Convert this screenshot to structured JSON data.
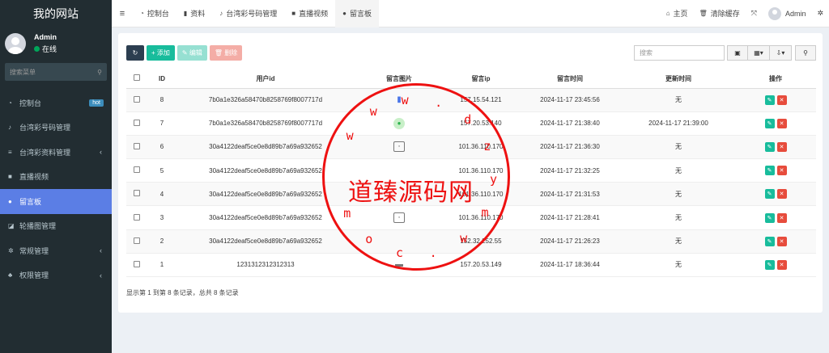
{
  "app": {
    "title": "我的网站"
  },
  "user": {
    "name": "Admin",
    "status": "在线"
  },
  "sidebar": {
    "search_placeholder": "搜索菜单",
    "items": [
      {
        "label": "控制台",
        "icon": "dashboard-icon",
        "badge": "hot"
      },
      {
        "label": "台湾彩号码管理",
        "icon": "bell-icon"
      },
      {
        "label": "台湾彩资料管理",
        "icon": "list-icon",
        "arrow": "‹"
      },
      {
        "label": "直播视频",
        "icon": "video-icon"
      },
      {
        "label": "留言板",
        "icon": "comment-icon"
      },
      {
        "label": "轮播图管理",
        "icon": "image-icon"
      },
      {
        "label": "常规管理",
        "icon": "cogs-icon",
        "arrow": "‹"
      },
      {
        "label": "权限管理",
        "icon": "users-icon",
        "arrow": "‹"
      }
    ]
  },
  "topbar": {
    "tabs": [
      {
        "label": "控制台",
        "icon": "dashboard-icon"
      },
      {
        "label": "资料",
        "icon": "bookmark-icon"
      },
      {
        "label": "台湾彩号码管理",
        "icon": "bell-icon"
      },
      {
        "label": "直播视频",
        "icon": "video-icon"
      },
      {
        "label": "留言板",
        "icon": "comment-icon"
      }
    ],
    "home": "主页",
    "clear_cache": "清除缓存",
    "admin": "Admin"
  },
  "toolbar": {
    "add": "添加",
    "edit": "编辑",
    "delete": "删除",
    "search_placeholder": "搜索"
  },
  "table": {
    "headers": [
      "ID",
      "用户id",
      "留言图片",
      "留言ip",
      "留言时间",
      "更新时间",
      "操作"
    ],
    "rows": [
      {
        "id": "8",
        "uid": "7b0a1e326a58470b8258769f8007717d",
        "thumb": "blue",
        "ip": "157.15.54.121",
        "time": "2024-11-17 23:45:56",
        "update": "无"
      },
      {
        "id": "7",
        "uid": "7b0a1e326a58470b8258769f8007717d",
        "thumb": "green",
        "ip": "157.20.53.140",
        "time": "2024-11-17 21:38:40",
        "update": "2024-11-17 21:39:00"
      },
      {
        "id": "6",
        "uid": "30a4122deaf5ce0e8d89b7a69a932652",
        "thumb": "box",
        "ip": "101.36.110.170",
        "time": "2024-11-17 21:36:30",
        "update": "无"
      },
      {
        "id": "5",
        "uid": "30a4122deaf5ce0e8d89b7a69a932652",
        "thumb": "",
        "ip": "101.36.110.170",
        "time": "2024-11-17 21:32:25",
        "update": "无"
      },
      {
        "id": "4",
        "uid": "30a4122deaf5ce0e8d89b7a69a932652",
        "thumb": "",
        "ip": "101.36.110.170",
        "time": "2024-11-17 21:31:53",
        "update": "无"
      },
      {
        "id": "3",
        "uid": "30a4122deaf5ce0e8d89b7a69a932652",
        "thumb": "box",
        "ip": "101.36.110.170",
        "time": "2024-11-17 21:28:41",
        "update": "无"
      },
      {
        "id": "2",
        "uid": "30a4122deaf5ce0e8d89b7a69a932652",
        "thumb": "",
        "ip": "152.32.252.55",
        "time": "2024-11-17 21:26:23",
        "update": "无"
      },
      {
        "id": "1",
        "uid": "1231312312312313",
        "thumb": "gray",
        "ip": "157.20.53.149",
        "time": "2024-11-17 18:36:44",
        "update": "无"
      }
    ]
  },
  "footer": {
    "summary": "显示第 1 到第 8 条记录，总共 8 条记录"
  },
  "watermark": {
    "center": "道臻源码网",
    "ring": "www.dzymw.com"
  },
  "colors": {
    "sidebar": "#222d32",
    "active": "#5b7ee5",
    "primary": "#18bc9c",
    "danger": "#e74c3c",
    "stamp": "#ee1111"
  }
}
